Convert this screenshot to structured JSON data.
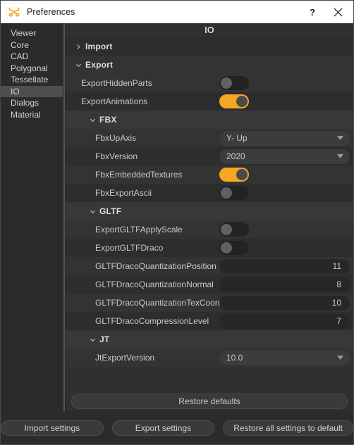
{
  "window": {
    "title": "Preferences",
    "icon": "app-logo-icon",
    "accent_color": "#f5a623",
    "titlebar_bg": "#ffffff",
    "help_label": "?",
    "close_label": "✕"
  },
  "sidebar": {
    "items": [
      {
        "label": "Viewer",
        "selected": false
      },
      {
        "label": "Core",
        "selected": false
      },
      {
        "label": "CAD",
        "selected": false
      },
      {
        "label": "Polygonal",
        "selected": false
      },
      {
        "label": "Tessellate",
        "selected": false
      },
      {
        "label": "IO",
        "selected": true
      },
      {
        "label": "Dialogs",
        "selected": false
      },
      {
        "label": "Material",
        "selected": false
      }
    ]
  },
  "main": {
    "panel_title": "IO",
    "groups": [
      {
        "label": "Import",
        "expanded": false,
        "chevron": "chevron-right-icon"
      },
      {
        "label": "Export",
        "expanded": true,
        "chevron": "chevron-down-icon"
      }
    ],
    "rows": [
      {
        "label": "ExportHiddenParts",
        "type": "toggle",
        "value": "off"
      },
      {
        "label": "ExportAnimations",
        "type": "toggle",
        "value": "on"
      },
      {
        "label": "FBX",
        "type": "section",
        "expanded": true
      },
      {
        "label": "FbxUpAxis",
        "type": "dropdown",
        "value": "Y- Up"
      },
      {
        "label": "FbxVersion",
        "type": "dropdown",
        "value": "2020"
      },
      {
        "label": "FbxEmbeddedTextures",
        "type": "toggle",
        "value": "on"
      },
      {
        "label": "FbxExportAscii",
        "type": "toggle",
        "value": "off"
      },
      {
        "label": "GLTF",
        "type": "section",
        "expanded": true
      },
      {
        "label": "ExportGLTFApplyScale",
        "type": "toggle",
        "value": "off"
      },
      {
        "label": "ExportGLTFDraco",
        "type": "toggle",
        "value": "off"
      },
      {
        "label": "GLTFDracoQuantizationPosition",
        "type": "number",
        "value": "11"
      },
      {
        "label": "GLTFDracoQuantizationNormal",
        "type": "number",
        "value": "8"
      },
      {
        "label": "GLTFDracoQuantizationTexCoord",
        "type": "number",
        "value": "10"
      },
      {
        "label": "GLTFDracoCompressionLevel",
        "type": "number",
        "value": "7"
      },
      {
        "label": "JT",
        "type": "section",
        "expanded": true
      },
      {
        "label": "JtExportVersion",
        "type": "dropdown",
        "value": "10.0"
      }
    ],
    "restore_defaults_label": "Restore defaults"
  },
  "footer": {
    "import_settings_label": "Import settings",
    "export_settings_label": "Export settings",
    "restore_all_label": "Restore all settings to default"
  }
}
